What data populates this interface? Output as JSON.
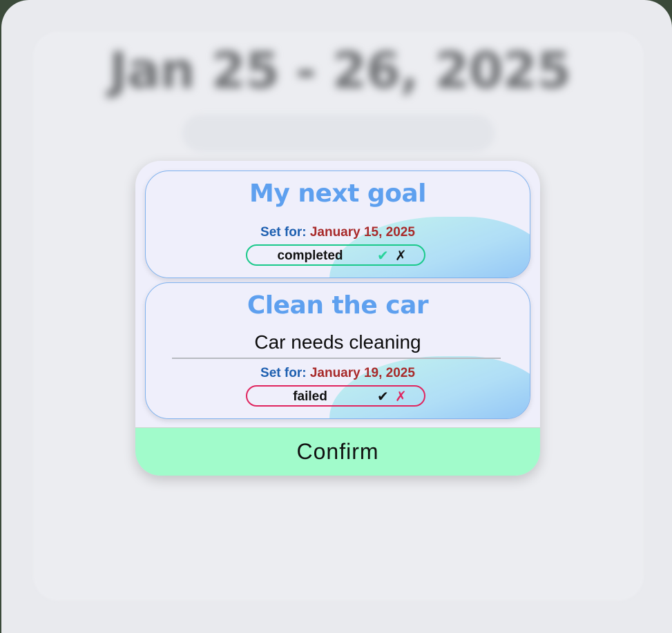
{
  "background": {
    "title": "Jan 25 - 26, 2025",
    "tabs": [
      "",
      "",
      "",
      ""
    ]
  },
  "modal": {
    "goals": [
      {
        "title": "My next goal",
        "description": "",
        "set_for_label": "Set for:",
        "date": "January 15, 2025",
        "status": "completed",
        "status_color": "#19c98a",
        "check_icon": "check-icon",
        "cross_icon": "cross-icon"
      },
      {
        "title": "Clean the car",
        "description": "Car needs cleaning",
        "set_for_label": "Set for:",
        "date": "January 19, 2025",
        "status": "failed",
        "status_color": "#e0245e",
        "check_icon": "check-icon",
        "cross_icon": "cross-icon"
      }
    ],
    "confirm_label": "Confirm"
  },
  "colors": {
    "title_blue": "#5ea0ef",
    "date_red": "#a82a2a",
    "label_blue": "#1d5fb0",
    "confirm_green": "#a1fbcb",
    "completed_green": "#19c98a",
    "failed_pink": "#e0245e"
  }
}
